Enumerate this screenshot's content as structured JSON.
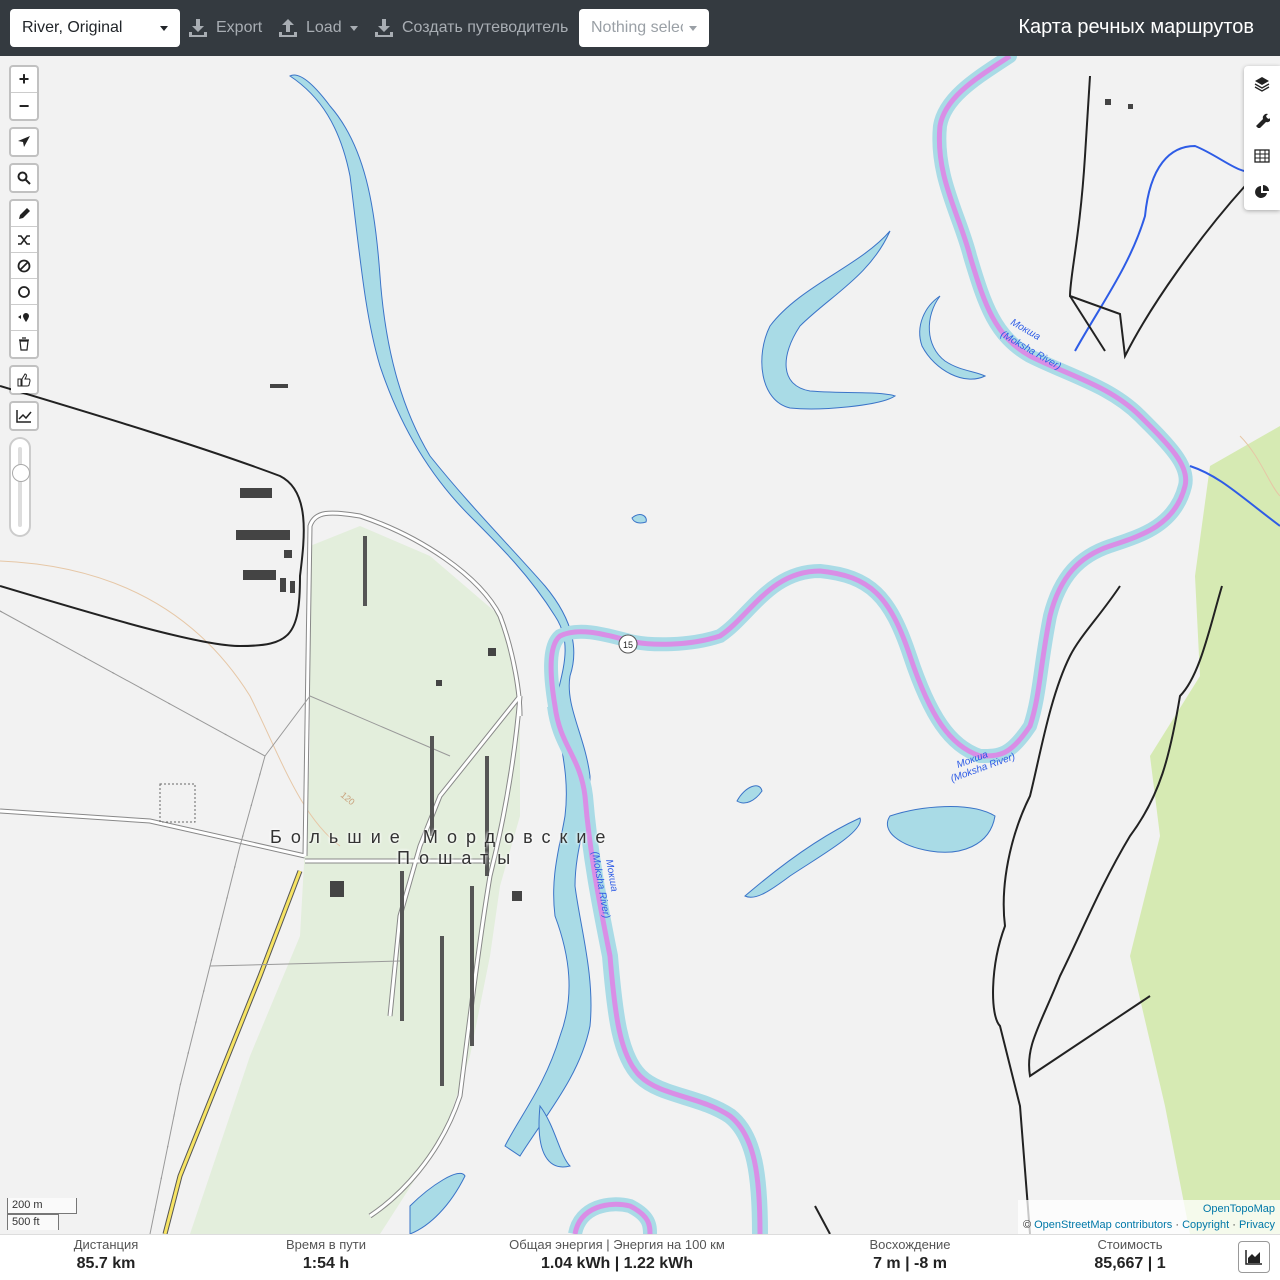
{
  "topbar": {
    "profile": "River, Original",
    "export": "Export",
    "load": "Load",
    "create_guide": "Создать путеводитель",
    "nothing_selected": "Nothing selected",
    "title": "Карта речных маршрутов"
  },
  "map": {
    "town_label_1": "Большие Мордовские",
    "town_label_2": "Пошаты",
    "river_labels": [
      "Мокша (Moksha River)",
      "Мокша (Moksha River)",
      "Мокша (Moksha River)"
    ],
    "road_ref": "15",
    "contour_label": "120",
    "scale_metric": "200 m",
    "scale_imperial": "500 ft",
    "attribution_tiles": "OpenTopoMap",
    "attribution_copy": "©",
    "attribution_osm": "OpenStreetMap contributors",
    "attribution_copyright": "Copyright",
    "attribution_privacy": "Privacy",
    "colors": {
      "water": "#a9dbe6",
      "route": "#d98ee6",
      "forest": "#d6eab3",
      "background": "#f2f2f2"
    }
  },
  "controls_left": [
    "zoom-in-icon",
    "zoom-out-icon",
    "locate-icon",
    "search-icon",
    "draw-icon",
    "shuffle-icon",
    "no-go-icon",
    "circle-icon",
    "waypoint-icon",
    "trash-icon",
    "thumb-icon",
    "chart-icon"
  ],
  "controls_right": [
    "layers-icon",
    "wrench-icon",
    "table-icon",
    "pie-icon"
  ],
  "stats": {
    "distance_label": "Дистанция",
    "distance_value": "85.7 km",
    "time_label": "Время в пути",
    "time_value": "1:54 h",
    "energy_label": "Общая энергия | Энергия на 100 км",
    "energy_value": "1.04 kWh | 1.22 kWh",
    "ascent_label": "Восхождение",
    "ascent_value": "7 m | -8 m",
    "cost_label": "Стоимость",
    "cost_value": "85,667 | 1"
  }
}
